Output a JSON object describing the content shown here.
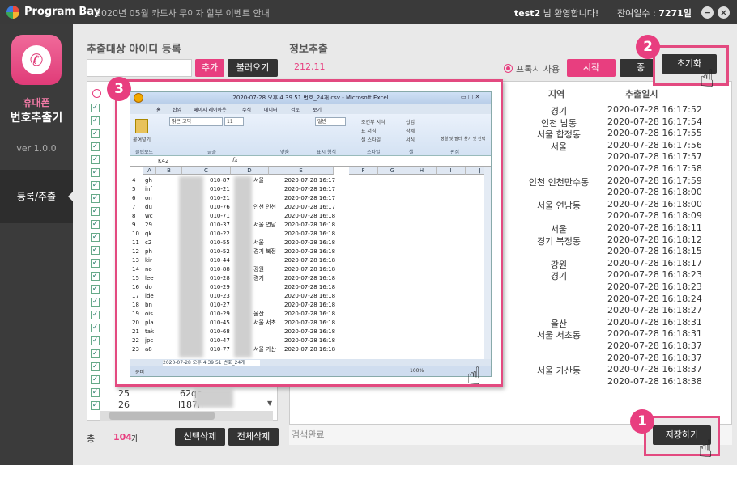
{
  "titlebar": {
    "app_name": "Program Bay",
    "notice": "2020년 05월 카드사 무이자 할부 이벤트 안내",
    "welcome_user": "test2",
    "welcome_suffix": " 님 환영합니다!",
    "days_label": "잔여일수 : ",
    "days_value": "7271일"
  },
  "sidebar": {
    "title1": "휴대폰",
    "title2": "번호추출기",
    "version": "ver 1.0.0",
    "nav": "등록/추출"
  },
  "left": {
    "heading": "추출대상 아이디 등록",
    "add": "추가",
    "load": "불러오기",
    "rows": [
      {
        "n": "25",
        "id": "62qc"
      },
      {
        "n": "26",
        "id": "l187n"
      }
    ],
    "total_label": "총",
    "total_value": "104",
    "total_unit": "개",
    "delete_selected": "선택삭제",
    "delete_all": "전체삭제"
  },
  "right": {
    "heading": "정보추출",
    "count": "212,11",
    "proxy": "프록시 사용",
    "start": "시작",
    "stop": "중",
    "reset": "초기화",
    "save": "저장하기",
    "status": "검색완료",
    "col_region": "지역",
    "col_date": "추출일시",
    "rows": [
      [
        "경기",
        "2020-07-28 16:17:52"
      ],
      [
        "인천 남동",
        "2020-07-28 16:17:54"
      ],
      [
        "서울 합정동",
        "2020-07-28 16:17:55"
      ],
      [
        "서울",
        "2020-07-28 16:17:56"
      ],
      [
        "",
        "2020-07-28 16:17:57"
      ],
      [
        "",
        "2020-07-28 16:17:58"
      ],
      [
        "인천 인천만수동",
        "2020-07-28 16:17:59"
      ],
      [
        "",
        "2020-07-28 16:18:00"
      ],
      [
        "서울 연남동",
        "2020-07-28 16:18:00"
      ],
      [
        "",
        "2020-07-28 16:18:09"
      ],
      [
        "서울",
        "2020-07-28 16:18:11"
      ],
      [
        "경기 복정동",
        "2020-07-28 16:18:12"
      ],
      [
        "",
        "2020-07-28 16:18:15"
      ],
      [
        "강원",
        "2020-07-28 16:18:17"
      ],
      [
        "경기",
        "2020-07-28 16:18:23"
      ],
      [
        "",
        "2020-07-28 16:18:23"
      ],
      [
        "",
        "2020-07-28 16:18:24"
      ],
      [
        "",
        "2020-07-28 16:18:27"
      ],
      [
        "울산",
        "2020-07-28 16:18:31"
      ],
      [
        "서울 서초동",
        "2020-07-28 16:18:31"
      ],
      [
        "",
        "2020-07-28 16:18:37"
      ],
      [
        "",
        "2020-07-28 16:18:37"
      ],
      [
        "서울 가산동",
        "2020-07-28 16:18:37"
      ],
      [
        "",
        "2020-07-28 16:18:38"
      ]
    ]
  },
  "badges": [
    "1",
    "2",
    "3"
  ],
  "excel": {
    "title": "2020-07-28 오후 4 39 51 번호_24개.csv - Microsoft Excel",
    "tabs": [
      "홈",
      "삽입",
      "페이지 레이아웃",
      "수식",
      "데이터",
      "검토",
      "보기"
    ],
    "ribbon": {
      "paste": "붙여넣기",
      "font": "맑은 고딕",
      "size": "11",
      "clipboard": "클립보드",
      "font_group": "글꼴",
      "align": "맞춤",
      "number": "표시 형식",
      "style": "스타일",
      "cells": "셀",
      "edit": "편집",
      "general": "일반",
      "cond": "조건부 서식",
      "table": "표 서식",
      "cellstyle": "셀 스타일",
      "insert": "삽입",
      "delete": "삭제",
      "format": "서식",
      "sort": "정렬 및 필터",
      "find": "찾기 및 선택"
    },
    "namebox": "K42",
    "cols": [
      "A",
      "B",
      "C",
      "D",
      "E",
      "F",
      "G",
      "H",
      "I",
      "J"
    ],
    "rows": [
      [
        "4",
        "gh",
        "010-87",
        "서울",
        "2020-07-28 16:17"
      ],
      [
        "5",
        "inf",
        "010-21",
        "",
        "2020-07-28 16:17"
      ],
      [
        "6",
        "on",
        "010-21",
        "",
        "2020-07-28 16:17"
      ],
      [
        "7",
        "du",
        "010-76",
        "인천 인천",
        "2020-07-28 16:17"
      ],
      [
        "8",
        "wc",
        "010-71",
        "",
        "2020-07-28 16:18"
      ],
      [
        "9",
        "29",
        "010-37",
        "서울 연남",
        "2020-07-28 16:18"
      ],
      [
        "10",
        "qk",
        "010-22",
        "",
        "2020-07-28 16:18"
      ],
      [
        "11",
        "c2",
        "010-55",
        "서울",
        "2020-07-28 16:18"
      ],
      [
        "12",
        "ph",
        "010-52",
        "경기 복정",
        "2020-07-28 16:18"
      ],
      [
        "13",
        "kir",
        "010-44",
        "",
        "2020-07-28 16:18"
      ],
      [
        "14",
        "no",
        "010-88",
        "강원",
        "2020-07-28 16:18"
      ],
      [
        "15",
        "lee",
        "010-28",
        "경기",
        "2020-07-28 16:18"
      ],
      [
        "16",
        "do",
        "010-29",
        "",
        "2020-07-28 16:18"
      ],
      [
        "17",
        "ide",
        "010-23",
        "",
        "2020-07-28 16:18"
      ],
      [
        "18",
        "bn",
        "010-27",
        "",
        "2020-07-28 16:18"
      ],
      [
        "19",
        "ois",
        "010-29",
        "울산",
        "2020-07-28 16:18"
      ],
      [
        "20",
        "pla",
        "010-45",
        "서울 서초",
        "2020-07-28 16:18"
      ],
      [
        "21",
        "tak",
        "010-68",
        "",
        "2020-07-28 16:18"
      ],
      [
        "22",
        "jpc",
        "010-47",
        "",
        "2020-07-28 16:18"
      ],
      [
        "23",
        "a8",
        "010-77",
        "서울 가산",
        "2020-07-28 16:18"
      ]
    ],
    "sheet_tab": "2020-07-28 오후 4 39 51 번호_24개",
    "ready": "준비",
    "zoom": "100%"
  }
}
